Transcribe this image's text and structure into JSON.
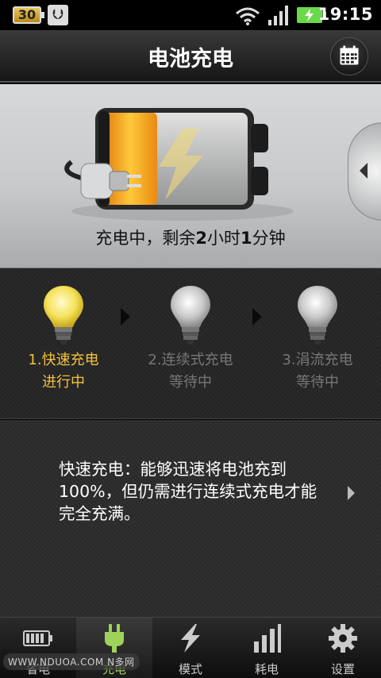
{
  "status_bar": {
    "battery_level": "30",
    "time": "19:15"
  },
  "header": {
    "title": "电池充电"
  },
  "battery": {
    "remaining_prefix": "充电中，剩余",
    "hours": "2",
    "hours_unit": "小时",
    "minutes": "1",
    "minutes_unit": "分钟"
  },
  "stages": [
    {
      "name": "1.快速充电",
      "status": "进行中"
    },
    {
      "name": "2.连续式充电",
      "status": "等待中"
    },
    {
      "name": "3.涓流充电",
      "status": "等待中"
    }
  ],
  "description": {
    "text": "快速充电：能够迅速将电池充到100%，但仍需进行连续式充电才能完全充满。"
  },
  "nav": {
    "items": [
      {
        "label": "省电",
        "icon": "battery-icon"
      },
      {
        "label": "充电",
        "icon": "plug-icon"
      },
      {
        "label": "模式",
        "icon": "bolt-icon"
      },
      {
        "label": "耗电",
        "icon": "bar-chart-icon"
      },
      {
        "label": "设置",
        "icon": "gear-icon"
      }
    ],
    "active_index": 1
  },
  "watermark": "WWW.NDUOA.COM N多网",
  "colors": {
    "accent_active": "#f2c23c",
    "nav_active": "#9fd25a",
    "charge_orange": "#f4a41c"
  }
}
